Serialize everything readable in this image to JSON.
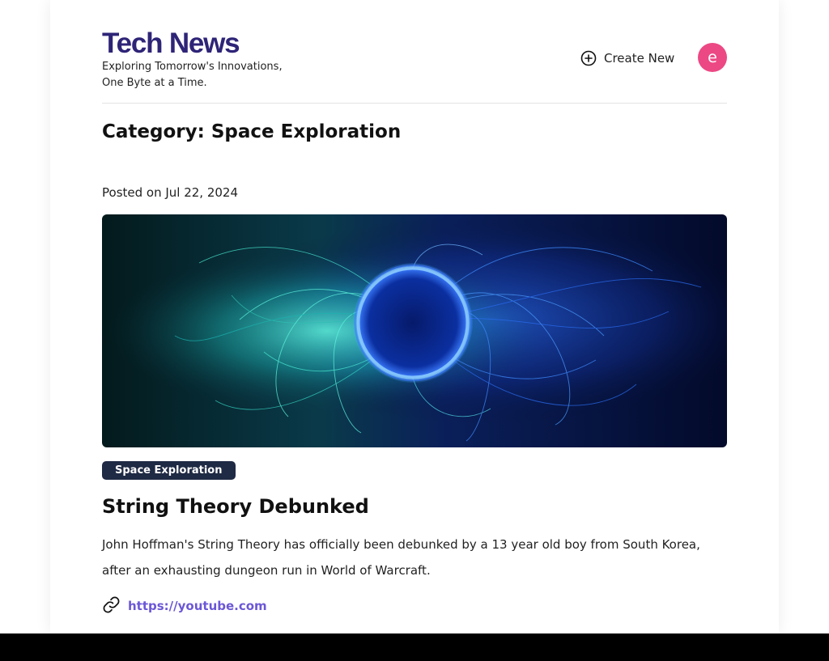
{
  "brand": {
    "title": "Tech News",
    "tagline": "Exploring Tomorrow's Innovations, One Byte at a Time."
  },
  "header": {
    "create_new_label": "Create New",
    "avatar_letter": "e"
  },
  "category": {
    "prefix": "Category: ",
    "name": "Space Exploration"
  },
  "post": {
    "posted_on": "Posted on Jul 22, 2024",
    "tag": "Space Exploration",
    "title": "String Theory Debunked",
    "body": "John Hoffman's String Theory has officially been debunked by a 13 year old boy from South Korea, after an exhausting dungeon run in World of Warcraft.",
    "link": "https://youtube.com"
  },
  "icons": {
    "create_new": "plus-circle-icon",
    "link": "link-icon"
  },
  "colors": {
    "brand": "#2e2477",
    "avatar": "#ec4884",
    "tag_bg": "#1f2a44",
    "link": "#6b57d6"
  }
}
